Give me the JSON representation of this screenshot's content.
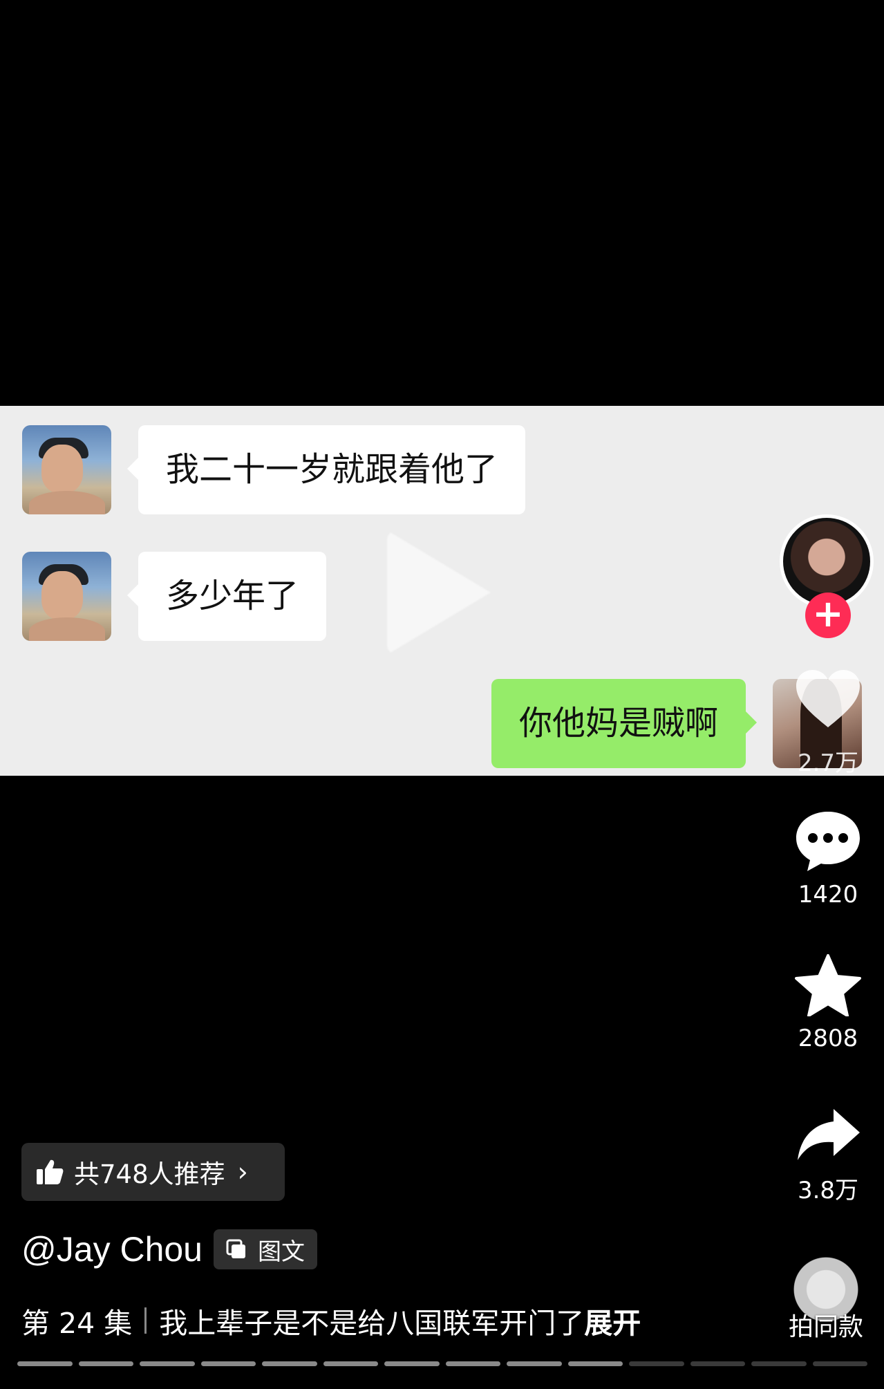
{
  "chat": {
    "messages": [
      {
        "side": "left",
        "text": "我二十一岁就跟着他了"
      },
      {
        "side": "left",
        "text": "多少年了"
      },
      {
        "side": "right",
        "text": "你他妈是贼啊"
      }
    ]
  },
  "rail": {
    "follow_symbol": "+",
    "likes": "2.7万",
    "comments": "1420",
    "favorites": "2808",
    "shares": "3.8万"
  },
  "recommend": {
    "label": "共748人推荐"
  },
  "author": {
    "name": "@Jay Chou",
    "tag": "图文"
  },
  "caption": {
    "episode": "第 24 集",
    "text": "我上辈子是不是给八国联军开门了",
    "expand": "展开"
  },
  "music": {
    "label": "拍同款"
  },
  "progress": {
    "segments_total": 14,
    "segments_done": 10
  },
  "colors": {
    "follow": "#fe2c55",
    "my_bubble": "#95ec69",
    "chat_bg": "#ededed"
  },
  "icons": [
    "comment-icon",
    "star-icon",
    "share-icon",
    "heart-icon",
    "thumbs-up-icon",
    "images-icon"
  ]
}
